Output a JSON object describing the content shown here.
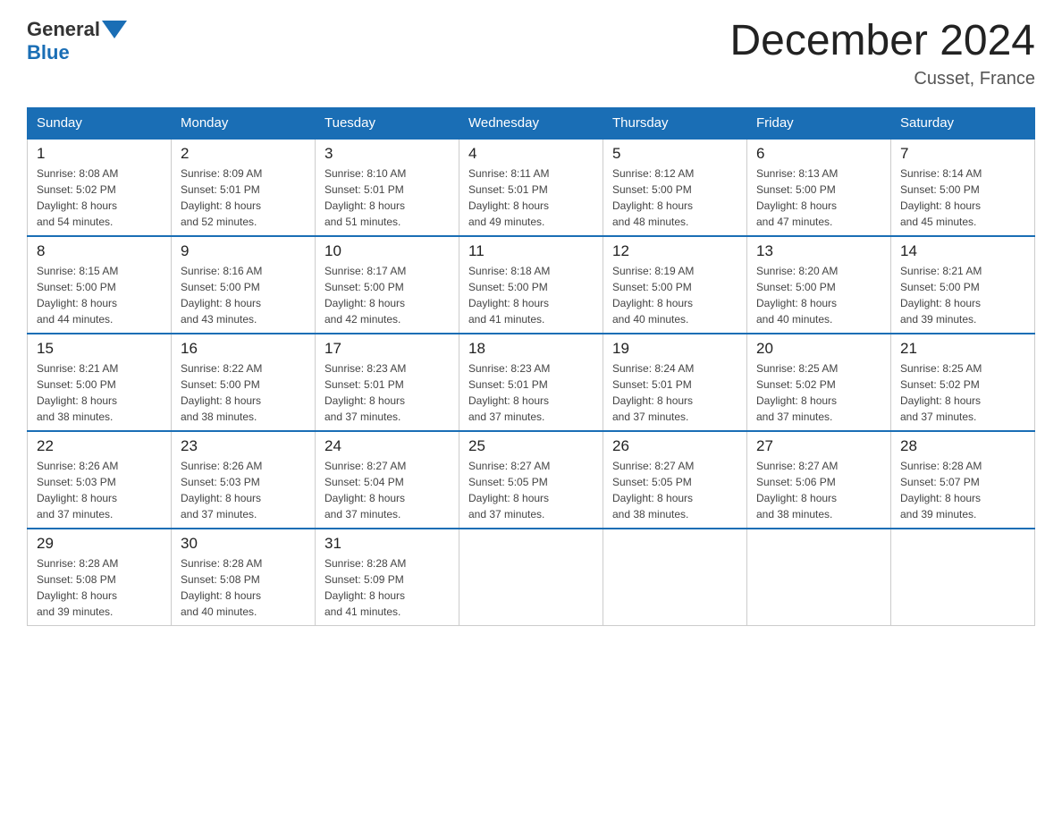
{
  "header": {
    "logo_general": "General",
    "logo_blue": "Blue",
    "title": "December 2024",
    "subtitle": "Cusset, France"
  },
  "weekdays": [
    "Sunday",
    "Monday",
    "Tuesday",
    "Wednesday",
    "Thursday",
    "Friday",
    "Saturday"
  ],
  "weeks": [
    [
      {
        "day": "1",
        "info": "Sunrise: 8:08 AM\nSunset: 5:02 PM\nDaylight: 8 hours\nand 54 minutes."
      },
      {
        "day": "2",
        "info": "Sunrise: 8:09 AM\nSunset: 5:01 PM\nDaylight: 8 hours\nand 52 minutes."
      },
      {
        "day": "3",
        "info": "Sunrise: 8:10 AM\nSunset: 5:01 PM\nDaylight: 8 hours\nand 51 minutes."
      },
      {
        "day": "4",
        "info": "Sunrise: 8:11 AM\nSunset: 5:01 PM\nDaylight: 8 hours\nand 49 minutes."
      },
      {
        "day": "5",
        "info": "Sunrise: 8:12 AM\nSunset: 5:00 PM\nDaylight: 8 hours\nand 48 minutes."
      },
      {
        "day": "6",
        "info": "Sunrise: 8:13 AM\nSunset: 5:00 PM\nDaylight: 8 hours\nand 47 minutes."
      },
      {
        "day": "7",
        "info": "Sunrise: 8:14 AM\nSunset: 5:00 PM\nDaylight: 8 hours\nand 45 minutes."
      }
    ],
    [
      {
        "day": "8",
        "info": "Sunrise: 8:15 AM\nSunset: 5:00 PM\nDaylight: 8 hours\nand 44 minutes."
      },
      {
        "day": "9",
        "info": "Sunrise: 8:16 AM\nSunset: 5:00 PM\nDaylight: 8 hours\nand 43 minutes."
      },
      {
        "day": "10",
        "info": "Sunrise: 8:17 AM\nSunset: 5:00 PM\nDaylight: 8 hours\nand 42 minutes."
      },
      {
        "day": "11",
        "info": "Sunrise: 8:18 AM\nSunset: 5:00 PM\nDaylight: 8 hours\nand 41 minutes."
      },
      {
        "day": "12",
        "info": "Sunrise: 8:19 AM\nSunset: 5:00 PM\nDaylight: 8 hours\nand 40 minutes."
      },
      {
        "day": "13",
        "info": "Sunrise: 8:20 AM\nSunset: 5:00 PM\nDaylight: 8 hours\nand 40 minutes."
      },
      {
        "day": "14",
        "info": "Sunrise: 8:21 AM\nSunset: 5:00 PM\nDaylight: 8 hours\nand 39 minutes."
      }
    ],
    [
      {
        "day": "15",
        "info": "Sunrise: 8:21 AM\nSunset: 5:00 PM\nDaylight: 8 hours\nand 38 minutes."
      },
      {
        "day": "16",
        "info": "Sunrise: 8:22 AM\nSunset: 5:00 PM\nDaylight: 8 hours\nand 38 minutes."
      },
      {
        "day": "17",
        "info": "Sunrise: 8:23 AM\nSunset: 5:01 PM\nDaylight: 8 hours\nand 37 minutes."
      },
      {
        "day": "18",
        "info": "Sunrise: 8:23 AM\nSunset: 5:01 PM\nDaylight: 8 hours\nand 37 minutes."
      },
      {
        "day": "19",
        "info": "Sunrise: 8:24 AM\nSunset: 5:01 PM\nDaylight: 8 hours\nand 37 minutes."
      },
      {
        "day": "20",
        "info": "Sunrise: 8:25 AM\nSunset: 5:02 PM\nDaylight: 8 hours\nand 37 minutes."
      },
      {
        "day": "21",
        "info": "Sunrise: 8:25 AM\nSunset: 5:02 PM\nDaylight: 8 hours\nand 37 minutes."
      }
    ],
    [
      {
        "day": "22",
        "info": "Sunrise: 8:26 AM\nSunset: 5:03 PM\nDaylight: 8 hours\nand 37 minutes."
      },
      {
        "day": "23",
        "info": "Sunrise: 8:26 AM\nSunset: 5:03 PM\nDaylight: 8 hours\nand 37 minutes."
      },
      {
        "day": "24",
        "info": "Sunrise: 8:27 AM\nSunset: 5:04 PM\nDaylight: 8 hours\nand 37 minutes."
      },
      {
        "day": "25",
        "info": "Sunrise: 8:27 AM\nSunset: 5:05 PM\nDaylight: 8 hours\nand 37 minutes."
      },
      {
        "day": "26",
        "info": "Sunrise: 8:27 AM\nSunset: 5:05 PM\nDaylight: 8 hours\nand 38 minutes."
      },
      {
        "day": "27",
        "info": "Sunrise: 8:27 AM\nSunset: 5:06 PM\nDaylight: 8 hours\nand 38 minutes."
      },
      {
        "day": "28",
        "info": "Sunrise: 8:28 AM\nSunset: 5:07 PM\nDaylight: 8 hours\nand 39 minutes."
      }
    ],
    [
      {
        "day": "29",
        "info": "Sunrise: 8:28 AM\nSunset: 5:08 PM\nDaylight: 8 hours\nand 39 minutes."
      },
      {
        "day": "30",
        "info": "Sunrise: 8:28 AM\nSunset: 5:08 PM\nDaylight: 8 hours\nand 40 minutes."
      },
      {
        "day": "31",
        "info": "Sunrise: 8:28 AM\nSunset: 5:09 PM\nDaylight: 8 hours\nand 41 minutes."
      },
      {
        "day": "",
        "info": ""
      },
      {
        "day": "",
        "info": ""
      },
      {
        "day": "",
        "info": ""
      },
      {
        "day": "",
        "info": ""
      }
    ]
  ]
}
